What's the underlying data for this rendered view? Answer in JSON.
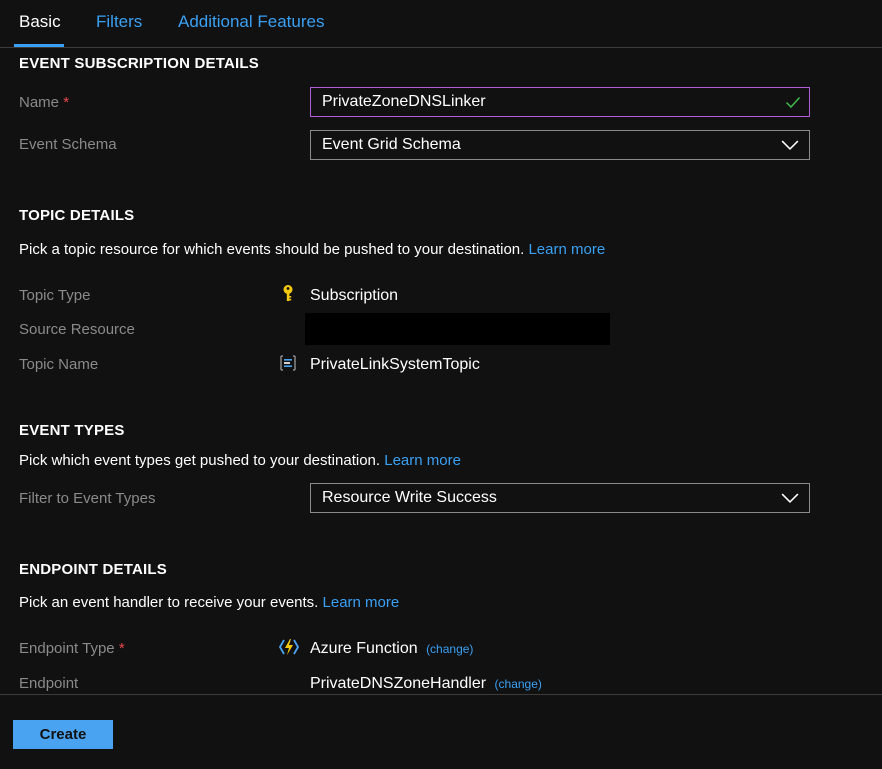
{
  "tabs": [
    {
      "label": "Basic",
      "active": true
    },
    {
      "label": "Filters",
      "active": false
    },
    {
      "label": "Additional Features",
      "active": false
    }
  ],
  "event_subscription": {
    "title": "EVENT SUBSCRIPTION DETAILS",
    "name_label": "Name",
    "required_mark": "*",
    "name_value": "PrivateZoneDNSLinker",
    "schema_label": "Event Schema",
    "schema_value": "Event Grid Schema"
  },
  "topic": {
    "title": "TOPIC DETAILS",
    "description": "Pick a topic resource for which events should be pushed to your destination.",
    "learn_more": "Learn more",
    "type_label": "Topic Type",
    "type_value": "Subscription",
    "source_label": "Source Resource",
    "name_label": "Topic Name",
    "name_value": "PrivateLinkSystemTopic"
  },
  "event_types": {
    "title": "EVENT TYPES",
    "description": "Pick which event types get pushed to your destination.",
    "learn_more": "Learn more",
    "filter_label": "Filter to Event Types",
    "filter_value": "Resource Write Success"
  },
  "endpoint": {
    "title": "ENDPOINT DETAILS",
    "description": "Pick an event handler to receive your events.",
    "learn_more": "Learn more",
    "type_label": "Endpoint Type",
    "required_mark": "*",
    "type_value": "Azure Function",
    "change_label": "(change)",
    "endpoint_label": "Endpoint",
    "endpoint_value": "PrivateDNSZoneHandler"
  },
  "footer": {
    "create_label": "Create"
  },
  "colors": {
    "background": "#111111",
    "accent": "#3aa0f3",
    "focus_border": "#b15bd9",
    "valid_check": "#3fb950",
    "required": "#e8484c"
  },
  "icons": {
    "topic_type": "key-icon",
    "topic_name": "system-topic-icon",
    "endpoint_type": "azure-function-icon",
    "dropdown": "chevron-down-icon",
    "valid": "checkmark-icon"
  }
}
